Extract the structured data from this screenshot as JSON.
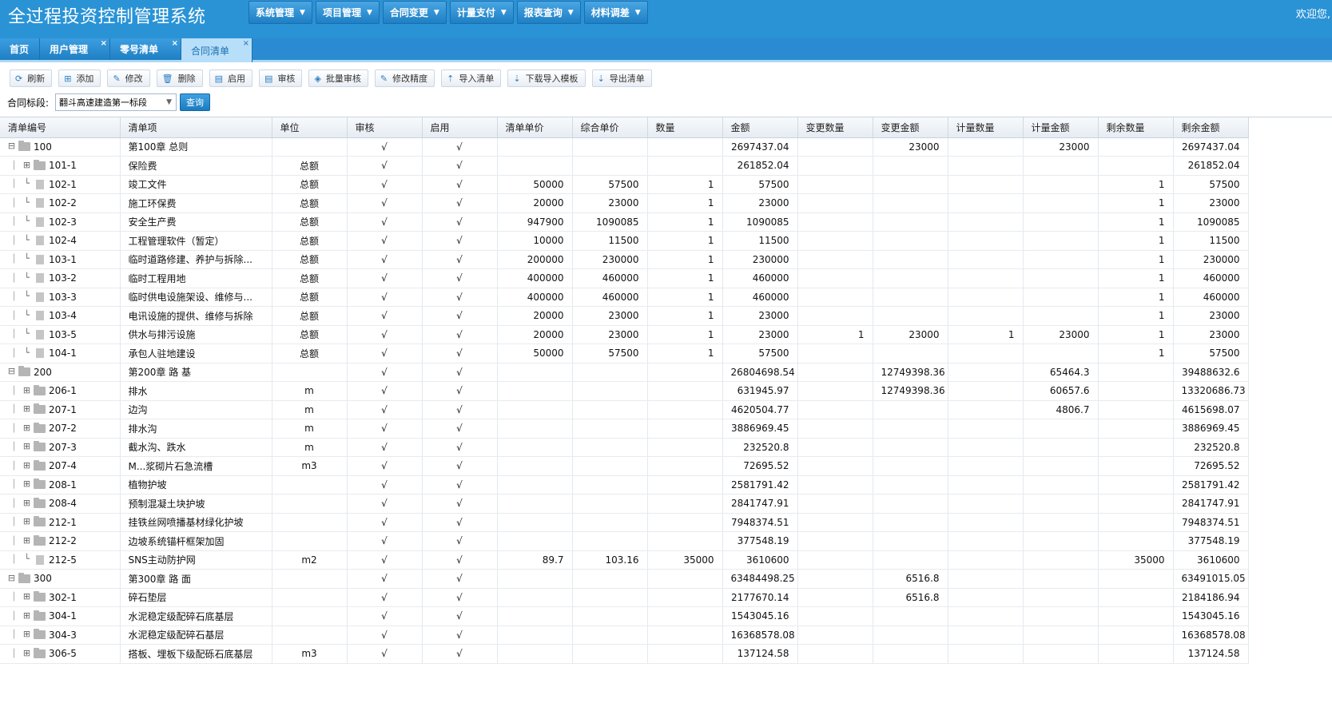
{
  "app": {
    "title": "全过程投资控制管理系统",
    "welcome": "欢迎您,"
  },
  "menus": [
    "系统管理",
    "项目管理",
    "合同变更",
    "计量支付",
    "报表查询",
    "材料调差"
  ],
  "tabs": [
    {
      "label": "首页",
      "closable": false,
      "active": false
    },
    {
      "label": "用户管理",
      "closable": true,
      "active": false
    },
    {
      "label": "零号清单",
      "closable": true,
      "active": false
    },
    {
      "label": "合同清单",
      "closable": true,
      "active": true
    }
  ],
  "toolbar": [
    {
      "label": "刷新",
      "icon": "refresh-icon"
    },
    {
      "label": "添加",
      "icon": "plus-icon"
    },
    {
      "label": "修改",
      "icon": "edit-icon"
    },
    {
      "label": "删除",
      "icon": "trash-icon"
    },
    {
      "label": "启用",
      "icon": "document-icon"
    },
    {
      "label": "审核",
      "icon": "document-icon"
    },
    {
      "label": "批量审核",
      "icon": "cube-icon"
    },
    {
      "label": "修改精度",
      "icon": "edit-icon"
    },
    {
      "label": "导入清单",
      "icon": "upload-icon"
    },
    {
      "label": "下载导入模板",
      "icon": "download-icon"
    },
    {
      "label": "导出清单",
      "icon": "download-icon"
    }
  ],
  "filter": {
    "label": "合同标段:",
    "value": "翻斗高速建造第一标段",
    "query_label": "查询"
  },
  "columns": [
    "清单编号",
    "清单项",
    "单位",
    "审核",
    "启用",
    "清单单价",
    "综合单价",
    "数量",
    "金额",
    "变更数量",
    "变更金额",
    "计量数量",
    "计量金额",
    "剩余数量",
    "剩余金额"
  ],
  "rows": [
    {
      "level": 0,
      "type": "folder",
      "expanded": true,
      "code": "100",
      "name": "第100章 总则",
      "unit": "",
      "audit": "√",
      "enabled": "√",
      "price": "",
      "comp_price": "",
      "qty": "",
      "amount": "2697437.04",
      "chg_qty": "",
      "chg_amount": "23000",
      "meas_qty": "",
      "meas_amount": "23000",
      "rem_qty": "",
      "rem_amount": "2697437.04"
    },
    {
      "level": 1,
      "type": "folder",
      "expanded": false,
      "code": "101-1",
      "name": "保险费",
      "unit": "总额",
      "audit": "√",
      "enabled": "√",
      "price": "",
      "comp_price": "",
      "qty": "",
      "amount": "261852.04",
      "chg_qty": "",
      "chg_amount": "",
      "meas_qty": "",
      "meas_amount": "",
      "rem_qty": "",
      "rem_amount": "261852.04"
    },
    {
      "level": 1,
      "type": "doc",
      "code": "102-1",
      "name": "竣工文件",
      "unit": "总额",
      "audit": "√",
      "enabled": "√",
      "price": "50000",
      "comp_price": "57500",
      "qty": "1",
      "amount": "57500",
      "chg_qty": "",
      "chg_amount": "",
      "meas_qty": "",
      "meas_amount": "",
      "rem_qty": "1",
      "rem_amount": "57500"
    },
    {
      "level": 1,
      "type": "doc",
      "code": "102-2",
      "name": "施工环保费",
      "unit": "总额",
      "audit": "√",
      "enabled": "√",
      "price": "20000",
      "comp_price": "23000",
      "qty": "1",
      "amount": "23000",
      "chg_qty": "",
      "chg_amount": "",
      "meas_qty": "",
      "meas_amount": "",
      "rem_qty": "1",
      "rem_amount": "23000"
    },
    {
      "level": 1,
      "type": "doc",
      "code": "102-3",
      "name": "安全生产费",
      "unit": "总额",
      "audit": "√",
      "enabled": "√",
      "price": "947900",
      "comp_price": "1090085",
      "qty": "1",
      "amount": "1090085",
      "chg_qty": "",
      "chg_amount": "",
      "meas_qty": "",
      "meas_amount": "",
      "rem_qty": "1",
      "rem_amount": "1090085"
    },
    {
      "level": 1,
      "type": "doc",
      "code": "102-4",
      "name": "工程管理软件（暂定）",
      "unit": "总额",
      "audit": "√",
      "enabled": "√",
      "price": "10000",
      "comp_price": "11500",
      "qty": "1",
      "amount": "11500",
      "chg_qty": "",
      "chg_amount": "",
      "meas_qty": "",
      "meas_amount": "",
      "rem_qty": "1",
      "rem_amount": "11500"
    },
    {
      "level": 1,
      "type": "doc",
      "code": "103-1",
      "name": "临时道路修建、养护与拆除...",
      "unit": "总额",
      "audit": "√",
      "enabled": "√",
      "price": "200000",
      "comp_price": "230000",
      "qty": "1",
      "amount": "230000",
      "chg_qty": "",
      "chg_amount": "",
      "meas_qty": "",
      "meas_amount": "",
      "rem_qty": "1",
      "rem_amount": "230000"
    },
    {
      "level": 1,
      "type": "doc",
      "code": "103-2",
      "name": "临时工程用地",
      "unit": "总额",
      "audit": "√",
      "enabled": "√",
      "price": "400000",
      "comp_price": "460000",
      "qty": "1",
      "amount": "460000",
      "chg_qty": "",
      "chg_amount": "",
      "meas_qty": "",
      "meas_amount": "",
      "rem_qty": "1",
      "rem_amount": "460000"
    },
    {
      "level": 1,
      "type": "doc",
      "code": "103-3",
      "name": "临时供电设施架设、维修与...",
      "unit": "总额",
      "audit": "√",
      "enabled": "√",
      "price": "400000",
      "comp_price": "460000",
      "qty": "1",
      "amount": "460000",
      "chg_qty": "",
      "chg_amount": "",
      "meas_qty": "",
      "meas_amount": "",
      "rem_qty": "1",
      "rem_amount": "460000"
    },
    {
      "level": 1,
      "type": "doc",
      "code": "103-4",
      "name": "电讯设施的提供、维修与拆除",
      "unit": "总额",
      "audit": "√",
      "enabled": "√",
      "price": "20000",
      "comp_price": "23000",
      "qty": "1",
      "amount": "23000",
      "chg_qty": "",
      "chg_amount": "",
      "meas_qty": "",
      "meas_amount": "",
      "rem_qty": "1",
      "rem_amount": "23000"
    },
    {
      "level": 1,
      "type": "doc",
      "code": "103-5",
      "name": "供水与排污设施",
      "unit": "总额",
      "audit": "√",
      "enabled": "√",
      "price": "20000",
      "comp_price": "23000",
      "qty": "1",
      "amount": "23000",
      "chg_qty": "1",
      "chg_amount": "23000",
      "meas_qty": "1",
      "meas_amount": "23000",
      "rem_qty": "1",
      "rem_amount": "23000"
    },
    {
      "level": 1,
      "type": "doc",
      "code": "104-1",
      "name": "承包人驻地建设",
      "unit": "总额",
      "audit": "√",
      "enabled": "√",
      "price": "50000",
      "comp_price": "57500",
      "qty": "1",
      "amount": "57500",
      "chg_qty": "",
      "chg_amount": "",
      "meas_qty": "",
      "meas_amount": "",
      "rem_qty": "1",
      "rem_amount": "57500"
    },
    {
      "level": 0,
      "type": "folder",
      "expanded": true,
      "code": "200",
      "name": "第200章 路 基",
      "unit": "",
      "audit": "√",
      "enabled": "√",
      "price": "",
      "comp_price": "",
      "qty": "",
      "amount": "26804698.54",
      "chg_qty": "",
      "chg_amount": "12749398.36",
      "meas_qty": "",
      "meas_amount": "65464.3",
      "rem_qty": "",
      "rem_amount": "39488632.6"
    },
    {
      "level": 1,
      "type": "folder",
      "expanded": false,
      "code": "206-1",
      "name": "排水",
      "unit": "m",
      "audit": "√",
      "enabled": "√",
      "price": "",
      "comp_price": "",
      "qty": "",
      "amount": "631945.97",
      "chg_qty": "",
      "chg_amount": "12749398.36",
      "meas_qty": "",
      "meas_amount": "60657.6",
      "rem_qty": "",
      "rem_amount": "13320686.73"
    },
    {
      "level": 1,
      "type": "folder",
      "expanded": false,
      "code": "207-1",
      "name": "边沟",
      "unit": "m",
      "audit": "√",
      "enabled": "√",
      "price": "",
      "comp_price": "",
      "qty": "",
      "amount": "4620504.77",
      "chg_qty": "",
      "chg_amount": "",
      "meas_qty": "",
      "meas_amount": "4806.7",
      "rem_qty": "",
      "rem_amount": "4615698.07"
    },
    {
      "level": 1,
      "type": "folder",
      "expanded": false,
      "code": "207-2",
      "name": "排水沟",
      "unit": "m",
      "audit": "√",
      "enabled": "√",
      "price": "",
      "comp_price": "",
      "qty": "",
      "amount": "3886969.45",
      "chg_qty": "",
      "chg_amount": "",
      "meas_qty": "",
      "meas_amount": "",
      "rem_qty": "",
      "rem_amount": "3886969.45"
    },
    {
      "level": 1,
      "type": "folder",
      "expanded": false,
      "code": "207-3",
      "name": "截水沟、跌水",
      "unit": "m",
      "audit": "√",
      "enabled": "√",
      "price": "",
      "comp_price": "",
      "qty": "",
      "amount": "232520.8",
      "chg_qty": "",
      "chg_amount": "",
      "meas_qty": "",
      "meas_amount": "",
      "rem_qty": "",
      "rem_amount": "232520.8"
    },
    {
      "level": 1,
      "type": "folder",
      "expanded": false,
      "code": "207-4",
      "name": "M...浆砌片石急流槽",
      "unit": "m3",
      "audit": "√",
      "enabled": "√",
      "price": "",
      "comp_price": "",
      "qty": "",
      "amount": "72695.52",
      "chg_qty": "",
      "chg_amount": "",
      "meas_qty": "",
      "meas_amount": "",
      "rem_qty": "",
      "rem_amount": "72695.52"
    },
    {
      "level": 1,
      "type": "folder",
      "expanded": false,
      "code": "208-1",
      "name": "植物护坡",
      "unit": "",
      "audit": "√",
      "enabled": "√",
      "price": "",
      "comp_price": "",
      "qty": "",
      "amount": "2581791.42",
      "chg_qty": "",
      "chg_amount": "",
      "meas_qty": "",
      "meas_amount": "",
      "rem_qty": "",
      "rem_amount": "2581791.42"
    },
    {
      "level": 1,
      "type": "folder",
      "expanded": false,
      "code": "208-4",
      "name": "预制混凝土块护坡",
      "unit": "",
      "audit": "√",
      "enabled": "√",
      "price": "",
      "comp_price": "",
      "qty": "",
      "amount": "2841747.91",
      "chg_qty": "",
      "chg_amount": "",
      "meas_qty": "",
      "meas_amount": "",
      "rem_qty": "",
      "rem_amount": "2841747.91"
    },
    {
      "level": 1,
      "type": "folder",
      "expanded": false,
      "code": "212-1",
      "name": "挂铁丝网喷播基材绿化护坡",
      "unit": "",
      "audit": "√",
      "enabled": "√",
      "price": "",
      "comp_price": "",
      "qty": "",
      "amount": "7948374.51",
      "chg_qty": "",
      "chg_amount": "",
      "meas_qty": "",
      "meas_amount": "",
      "rem_qty": "",
      "rem_amount": "7948374.51"
    },
    {
      "level": 1,
      "type": "folder",
      "expanded": false,
      "code": "212-2",
      "name": "边坡系统锚杆框架加固",
      "unit": "",
      "audit": "√",
      "enabled": "√",
      "price": "",
      "comp_price": "",
      "qty": "",
      "amount": "377548.19",
      "chg_qty": "",
      "chg_amount": "",
      "meas_qty": "",
      "meas_amount": "",
      "rem_qty": "",
      "rem_amount": "377548.19"
    },
    {
      "level": 1,
      "type": "doc",
      "code": "212-5",
      "name": "SNS主动防护网",
      "unit": "m2",
      "audit": "√",
      "enabled": "√",
      "price": "89.7",
      "comp_price": "103.16",
      "qty": "35000",
      "amount": "3610600",
      "chg_qty": "",
      "chg_amount": "",
      "meas_qty": "",
      "meas_amount": "",
      "rem_qty": "35000",
      "rem_amount": "3610600"
    },
    {
      "level": 0,
      "type": "folder",
      "expanded": true,
      "code": "300",
      "name": "第300章 路 面",
      "unit": "",
      "audit": "√",
      "enabled": "√",
      "price": "",
      "comp_price": "",
      "qty": "",
      "amount": "63484498.25",
      "chg_qty": "",
      "chg_amount": "6516.8",
      "meas_qty": "",
      "meas_amount": "",
      "rem_qty": "",
      "rem_amount": "63491015.05"
    },
    {
      "level": 1,
      "type": "folder",
      "expanded": false,
      "code": "302-1",
      "name": "碎石垫层",
      "unit": "",
      "audit": "√",
      "enabled": "√",
      "price": "",
      "comp_price": "",
      "qty": "",
      "amount": "2177670.14",
      "chg_qty": "",
      "chg_amount": "6516.8",
      "meas_qty": "",
      "meas_amount": "",
      "rem_qty": "",
      "rem_amount": "2184186.94"
    },
    {
      "level": 1,
      "type": "folder",
      "expanded": false,
      "code": "304-1",
      "name": "水泥稳定级配碎石底基层",
      "unit": "",
      "audit": "√",
      "enabled": "√",
      "price": "",
      "comp_price": "",
      "qty": "",
      "amount": "1543045.16",
      "chg_qty": "",
      "chg_amount": "",
      "meas_qty": "",
      "meas_amount": "",
      "rem_qty": "",
      "rem_amount": "1543045.16"
    },
    {
      "level": 1,
      "type": "folder",
      "expanded": false,
      "code": "304-3",
      "name": "水泥稳定级配碎石基层",
      "unit": "",
      "audit": "√",
      "enabled": "√",
      "price": "",
      "comp_price": "",
      "qty": "",
      "amount": "16368578.08",
      "chg_qty": "",
      "chg_amount": "",
      "meas_qty": "",
      "meas_amount": "",
      "rem_qty": "",
      "rem_amount": "16368578.08"
    },
    {
      "level": 1,
      "type": "folder",
      "expanded": false,
      "code": "306-5",
      "name": "搭板、埋板下级配砾石底基层",
      "unit": "m3",
      "audit": "√",
      "enabled": "√",
      "price": "",
      "comp_price": "",
      "qty": "",
      "amount": "137124.58",
      "chg_qty": "",
      "chg_amount": "",
      "meas_qty": "",
      "meas_amount": "",
      "rem_qty": "",
      "rem_amount": "137124.58"
    }
  ]
}
